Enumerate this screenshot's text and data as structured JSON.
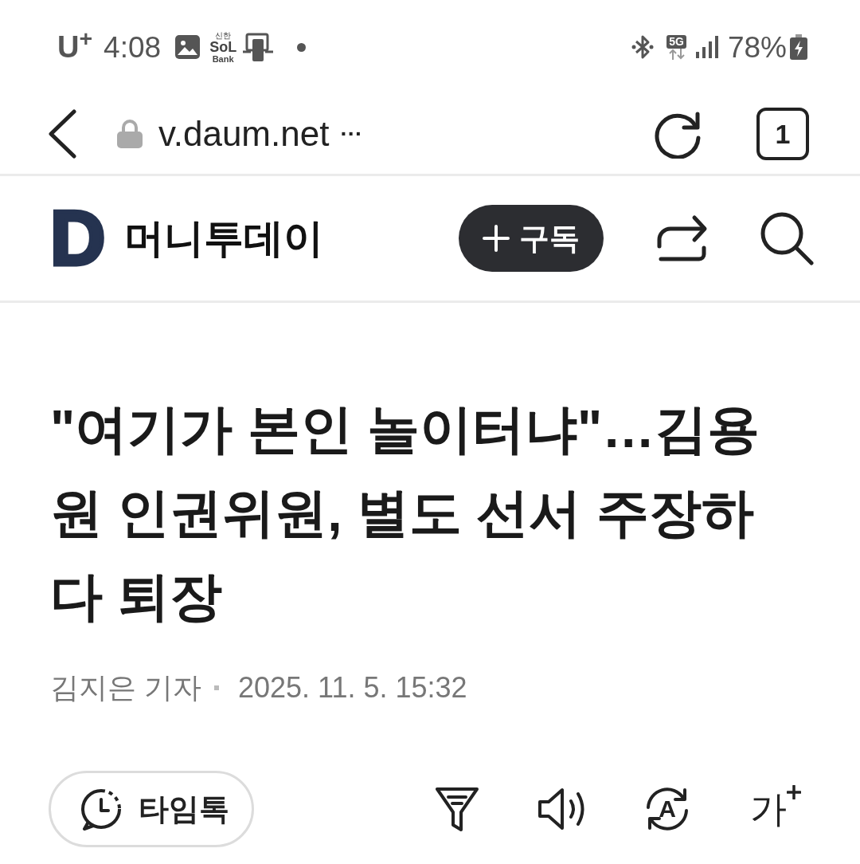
{
  "status_bar": {
    "carrier": "U$^{+}$",
    "time": "4:08",
    "bank_app": {
      "brand": "신한",
      "logo": "SoL",
      "caption": "Bank"
    },
    "network": "5G",
    "battery": "78%"
  },
  "browser_bar": {
    "url": "v.daum.net",
    "more": "···",
    "tab_count": "1"
  },
  "header": {
    "logo": "D",
    "publisher": "머니투데이",
    "subscribe_button": "구독"
  },
  "article": {
    "headline": "\"여기가 본인 놀이터냐\"…김용원 인권위원, 별도 선서 주장하다 퇴장",
    "author": "김지은 기자",
    "published": "2025. 11. 5. 15:32"
  },
  "toolbar": {
    "timetalk_button": "타임톡",
    "translate_button": "A",
    "font_size_button": "가"
  }
}
